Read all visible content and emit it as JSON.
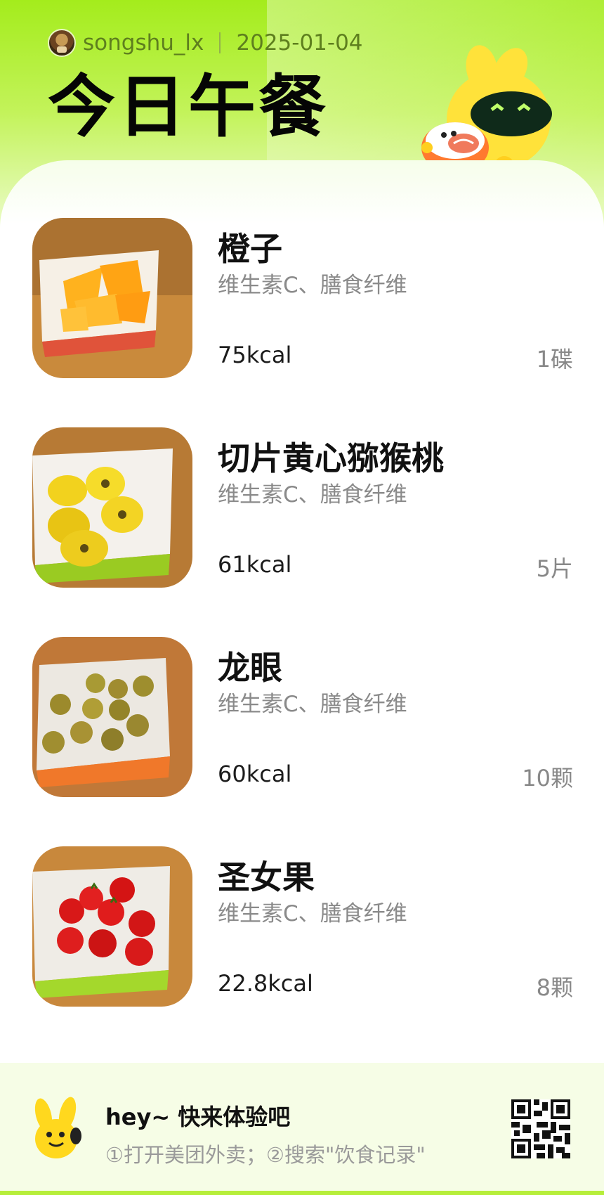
{
  "header": {
    "username": "songshu_lx",
    "date": "2025-01-04",
    "title": "今日午餐"
  },
  "foods": [
    {
      "name": "橙子",
      "nutrients": "维生素C、膳食纤维",
      "kcal": "75kcal",
      "quantity": "1碟",
      "photo": "orange-slices-photo"
    },
    {
      "name": "切片黄心猕猴桃",
      "nutrients": "维生素C、膳食纤维",
      "kcal": "61kcal",
      "quantity": "5片",
      "photo": "kiwi-slices-photo"
    },
    {
      "name": "龙眼",
      "nutrients": "维生素C、膳食纤维",
      "kcal": "60kcal",
      "quantity": "10颗",
      "photo": "longan-photo"
    },
    {
      "name": "圣女果",
      "nutrients": "维生素C、膳食纤维",
      "kcal": "22.8kcal",
      "quantity": "8颗",
      "photo": "cherry-tomato-photo"
    }
  ],
  "footer": {
    "title": "hey~ 快来体验吧",
    "steps": "①打开美团外卖；②搜索\"饮食记录\"",
    "qr": "qr-code-icon"
  },
  "colors": {
    "brand_green": "#a4ec1c",
    "mascot_yellow": "#ffe23a",
    "nutrient_gray": "#8a8a8a"
  }
}
